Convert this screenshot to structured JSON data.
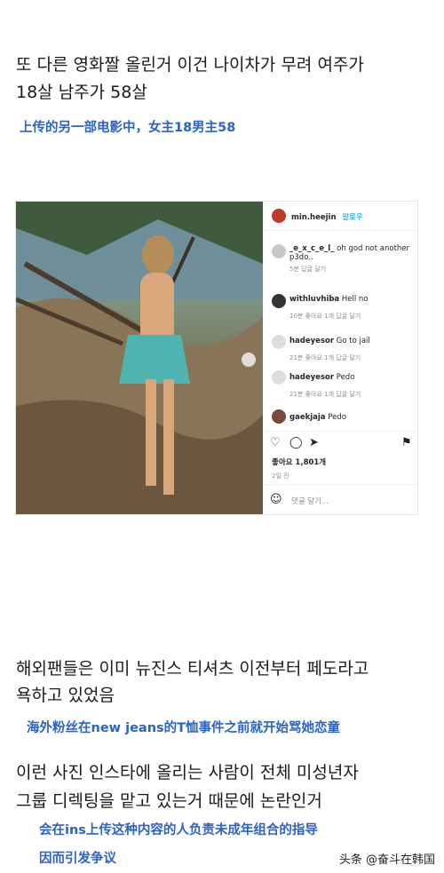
{
  "paragraph1": {
    "korean_line1": "또 다른 영화짤 올린거 이건 나이차가 무려 여주가",
    "korean_line2": "18살 남주가 58살",
    "chinese": "上传的另一部电影中，女主18男主58"
  },
  "instagram": {
    "owner": "min.heejin",
    "follow": "팔로우",
    "comments": [
      {
        "user": "_e_x_c_e_l_",
        "text": "oh god not another p3do..",
        "meta": "5분   답글 달기"
      },
      {
        "user": "withluvhiba",
        "text": "Hell no",
        "meta": "10분   좋아요 1개   답글 달기"
      },
      {
        "user": "hadeyesor",
        "text": "Go to jail",
        "meta": "21분   좋아요 1개   답글 달기"
      },
      {
        "user": "hadeyesor",
        "text": "Pedo",
        "meta": "21분   좋아요 1개   답글 달기"
      },
      {
        "user": "gaekjaja",
        "text": "Pedo",
        "meta": ""
      }
    ],
    "likes": "좋아요 1,801개",
    "date": "2일 전",
    "comment_placeholder": "댓글 달기..."
  },
  "paragraph2": {
    "korean_line1": "해외팬들은 이미 뉴진스 티셔츠 이전부터 페도라고",
    "korean_line2": "욕하고 있었음",
    "chinese": "海外粉丝在new jeans的T恤事件之前就开始骂她恋童"
  },
  "paragraph3": {
    "korean_line1": "이런 사진 인스타에 올리는 사람이 전체 미성년자",
    "korean_line2": "그룹 디렉팅을 맡고 있는거 때문에 논란인거",
    "chinese_line1": "会在ins上传这种内容的人负责未成年组合的指导",
    "chinese_line2": "因而引发争议"
  },
  "watermark": "头条 @奋斗在韩国",
  "colors": {
    "chinese_caption": "#2a63c9",
    "follow_link": "#0095f6"
  }
}
